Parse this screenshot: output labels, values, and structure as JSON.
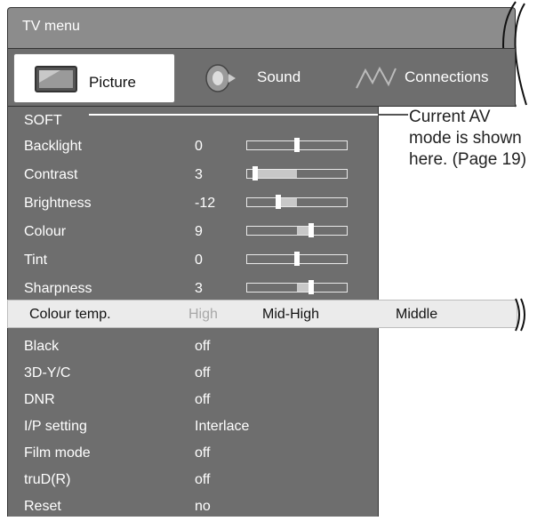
{
  "header": {
    "title": "TV menu"
  },
  "tabs": [
    {
      "label": "Picture"
    },
    {
      "label": "Sound"
    },
    {
      "label": "Connections"
    }
  ],
  "menu": {
    "mode": "SOFT",
    "rows": [
      {
        "label": "Backlight",
        "value": "0",
        "level": 0.5
      },
      {
        "label": "Contrast",
        "value": "3",
        "level": 0.06
      },
      {
        "label": "Brightness",
        "value": "-12",
        "level": 0.3
      },
      {
        "label": "Colour",
        "value": "9",
        "level": 0.65
      },
      {
        "label": "Tint",
        "value": "0",
        "level": 0.5
      },
      {
        "label": "Sharpness",
        "value": "3",
        "level": 0.65
      }
    ],
    "highlight": {
      "label": "Colour temp.",
      "options": [
        "High",
        "Mid-High",
        "Middle"
      ]
    },
    "lower_rows": [
      {
        "label": "Black",
        "value": "off"
      },
      {
        "label": "3D-Y/C",
        "value": "off"
      },
      {
        "label": "DNR",
        "value": "off"
      },
      {
        "label": "I/P setting",
        "value": "Interlace"
      },
      {
        "label": "Film mode",
        "value": "off"
      },
      {
        "label": "truD(R)",
        "value": "off"
      },
      {
        "label": "Reset",
        "value": "no"
      }
    ]
  },
  "callout": {
    "line1": "Current AV",
    "line2": "mode is shown",
    "line3": "here. (Page 19)"
  }
}
